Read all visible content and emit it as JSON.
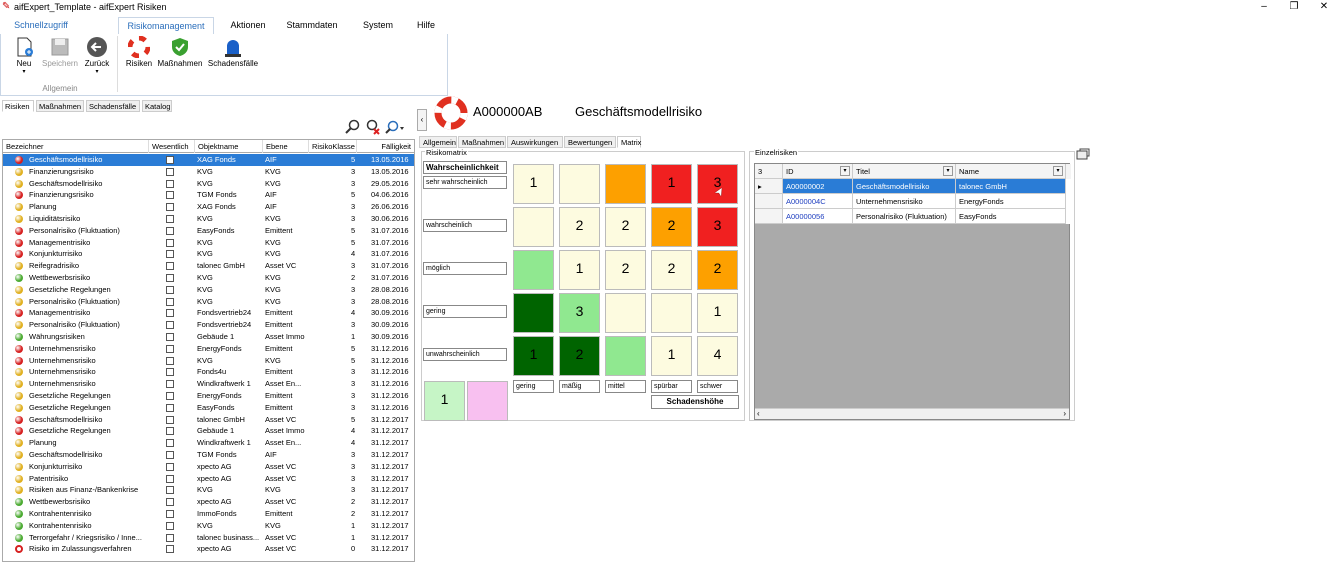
{
  "window": {
    "title": "aifExpert_Template - aifExpert Risiken"
  },
  "ribbon": {
    "tabs": [
      "Schnellzugriff",
      "Risikomanagement",
      "Aktionen",
      "Stammdaten",
      "System",
      "Hilfe"
    ],
    "group_allgemein": "Allgemein",
    "new_label": "Neu",
    "save_label": "Speichern",
    "back_label": "Zurück",
    "risks_label": "Risiken",
    "measures_label": "Maßnahmen",
    "damages_label": "Schadensfälle"
  },
  "left_tabs": [
    "Risiken",
    "Maßnahmen",
    "Schadensfälle",
    "Katalog"
  ],
  "grid": {
    "columns": [
      "Bezeichner",
      "Wesentlich",
      "Objektname",
      "Ebene",
      "RisikoKlasse",
      "Fälligkeit"
    ],
    "rows": [
      {
        "name": "Geschäftsmodellrisiko",
        "obj": "XAG Fonds",
        "level": "AIF",
        "cls": "5",
        "due": "13.05.2016",
        "color": "#d62020",
        "sel": true
      },
      {
        "name": "Finanzierungsrisiko",
        "obj": "KVG",
        "level": "KVG",
        "cls": "3",
        "due": "13.05.2016",
        "color": "#e0b020"
      },
      {
        "name": "Geschäftsmodellrisiko",
        "obj": "KVG",
        "level": "KVG",
        "cls": "3",
        "due": "29.05.2016",
        "color": "#e0b020"
      },
      {
        "name": "Finanzierungsrisiko",
        "obj": "TGM Fonds",
        "level": "AIF",
        "cls": "5",
        "due": "04.06.2016",
        "color": "#d62020"
      },
      {
        "name": "Planung",
        "obj": "XAG Fonds",
        "level": "AIF",
        "cls": "3",
        "due": "26.06.2016",
        "color": "#e0b020"
      },
      {
        "name": "Liquiditätsrisiko",
        "obj": "KVG",
        "level": "KVG",
        "cls": "3",
        "due": "30.06.2016",
        "color": "#e0b020"
      },
      {
        "name": "Personalrisiko (Fluktuation)",
        "obj": "EasyFonds",
        "level": "Emittent",
        "cls": "5",
        "due": "31.07.2016",
        "color": "#d62020"
      },
      {
        "name": "Managementrisiko",
        "obj": "KVG",
        "level": "KVG",
        "cls": "5",
        "due": "31.07.2016",
        "color": "#d62020"
      },
      {
        "name": "Konjunkturrisiko",
        "obj": "KVG",
        "level": "KVG",
        "cls": "4",
        "due": "31.07.2016",
        "color": "#d62020"
      },
      {
        "name": "Reifegradrisiko",
        "obj": "talonec GmbH",
        "level": "Asset VC",
        "cls": "3",
        "due": "31.07.2016",
        "color": "#e0b020"
      },
      {
        "name": "Wettbewerbsrisiko",
        "obj": "KVG",
        "level": "KVG",
        "cls": "2",
        "due": "31.07.2016",
        "color": "#4aaa30"
      },
      {
        "name": "Gesetzliche Regelungen",
        "obj": "KVG",
        "level": "KVG",
        "cls": "3",
        "due": "28.08.2016",
        "color": "#e0b020"
      },
      {
        "name": "Personalrisiko (Fluktuation)",
        "obj": "KVG",
        "level": "KVG",
        "cls": "3",
        "due": "28.08.2016",
        "color": "#e0b020"
      },
      {
        "name": "Managementrisiko",
        "obj": "Fondsvertrieb24",
        "level": "Emittent",
        "cls": "4",
        "due": "30.09.2016",
        "color": "#d62020"
      },
      {
        "name": "Personalrisiko (Fluktuation)",
        "obj": "Fondsvertrieb24",
        "level": "Emittent",
        "cls": "3",
        "due": "30.09.2016",
        "color": "#e0b020"
      },
      {
        "name": "Währungsrisiken",
        "obj": "Gebäude 1",
        "level": "Asset Immo",
        "cls": "1",
        "due": "30.09.2016",
        "color": "#4aaa30"
      },
      {
        "name": "Unternehmensrisiko",
        "obj": "EnergyFonds",
        "level": "Emittent",
        "cls": "5",
        "due": "31.12.2016",
        "color": "#d62020"
      },
      {
        "name": "Unternehmensrisiko",
        "obj": "KVG",
        "level": "KVG",
        "cls": "5",
        "due": "31.12.2016",
        "color": "#d62020"
      },
      {
        "name": "Unternehmensrisiko",
        "obj": "Fonds4u",
        "level": "Emittent",
        "cls": "3",
        "due": "31.12.2016",
        "color": "#e0b020"
      },
      {
        "name": "Unternehmensrisiko",
        "obj": "Windkraftwerk 1",
        "level": "Asset En...",
        "cls": "3",
        "due": "31.12.2016",
        "color": "#e0b020"
      },
      {
        "name": "Gesetzliche Regelungen",
        "obj": "EnergyFonds",
        "level": "Emittent",
        "cls": "3",
        "due": "31.12.2016",
        "color": "#e0b020"
      },
      {
        "name": "Gesetzliche Regelungen",
        "obj": "EasyFonds",
        "level": "Emittent",
        "cls": "3",
        "due": "31.12.2016",
        "color": "#e0b020"
      },
      {
        "name": "Geschäftsmodellrisiko",
        "obj": "talonec GmbH",
        "level": "Asset VC",
        "cls": "5",
        "due": "31.12.2017",
        "color": "#d62020"
      },
      {
        "name": "Gesetzliche Regelungen",
        "obj": "Gebäude 1",
        "level": "Asset Immo",
        "cls": "4",
        "due": "31.12.2017",
        "color": "#d62020"
      },
      {
        "name": "Planung",
        "obj": "Windkraftwerk 1",
        "level": "Asset En...",
        "cls": "4",
        "due": "31.12.2017",
        "color": "#e0b020"
      },
      {
        "name": "Geschäftsmodellrisiko",
        "obj": "TGM Fonds",
        "level": "AIF",
        "cls": "3",
        "due": "31.12.2017",
        "color": "#e0b020"
      },
      {
        "name": "Konjunkturrisiko",
        "obj": "xpecto AG",
        "level": "Asset VC",
        "cls": "3",
        "due": "31.12.2017",
        "color": "#e0b020"
      },
      {
        "name": "Patentrisiko",
        "obj": "xpecto AG",
        "level": "Asset VC",
        "cls": "3",
        "due": "31.12.2017",
        "color": "#e0b020"
      },
      {
        "name": "Risiken aus Finanz-/Bankenkrise",
        "obj": "KVG",
        "level": "KVG",
        "cls": "3",
        "due": "31.12.2017",
        "color": "#e0b020"
      },
      {
        "name": "Wettbewerbsrisiko",
        "obj": "xpecto AG",
        "level": "Asset VC",
        "cls": "2",
        "due": "31.12.2017",
        "color": "#4aaa30"
      },
      {
        "name": "Kontrahentenrisiko",
        "obj": "ImmoFonds",
        "level": "Emittent",
        "cls": "2",
        "due": "31.12.2017",
        "color": "#4aaa30"
      },
      {
        "name": "Kontrahentenrisiko",
        "obj": "KVG",
        "level": "KVG",
        "cls": "1",
        "due": "31.12.2017",
        "color": "#4aaa30"
      },
      {
        "name": "Terrorgefahr / Kriegsrisiko / Inne...",
        "obj": "talonec businass...",
        "level": "Asset VC",
        "cls": "1",
        "due": "31.12.2017",
        "color": "#4aaa30"
      },
      {
        "name": "Risiko im Zulassungsverfahren",
        "obj": "xpecto AG",
        "level": "Asset VC",
        "cls": "0",
        "due": "31.12.2017",
        "color": "#d62020",
        "ring": true
      }
    ]
  },
  "detail": {
    "id": "A000000AB",
    "name": "Geschäftsmodellrisiko",
    "tabs": [
      "Allgemein",
      "Maßnahmen",
      "Auswirkungen",
      "Bewertungen",
      "Matrix"
    ]
  },
  "matrix": {
    "group_label": "Risikomatrix",
    "prob_header": "Wahrscheinlichkeit",
    "prob_labels": [
      "sehr wahrscheinlich",
      "wahrscheinlich",
      "möglich",
      "gering",
      "unwahrscheinlich"
    ],
    "severity_labels": [
      "gering",
      "mäßig",
      "mittel",
      "spürbar",
      "schwer"
    ],
    "severity_header": "Schadenshöhe",
    "cells": [
      [
        {
          "v": "1",
          "c": "#fdfbe0"
        },
        {
          "v": "",
          "c": "#fdfbe0"
        },
        {
          "v": "",
          "c": "#fda000"
        },
        {
          "v": "1",
          "c": "#f02020"
        },
        {
          "v": "3",
          "c": "#f02020"
        }
      ],
      [
        {
          "v": "",
          "c": "#fdfbe0"
        },
        {
          "v": "2",
          "c": "#fdfbe0"
        },
        {
          "v": "2",
          "c": "#fdfbe0"
        },
        {
          "v": "2",
          "c": "#fda000"
        },
        {
          "v": "3",
          "c": "#f02020"
        }
      ],
      [
        {
          "v": "",
          "c": "#90e890"
        },
        {
          "v": "1",
          "c": "#fdfbe0"
        },
        {
          "v": "2",
          "c": "#fdfbe0"
        },
        {
          "v": "2",
          "c": "#fdfbe0"
        },
        {
          "v": "2",
          "c": "#fda000"
        }
      ],
      [
        {
          "v": "",
          "c": "#006400"
        },
        {
          "v": "3",
          "c": "#90e890"
        },
        {
          "v": "",
          "c": "#fdfbe0"
        },
        {
          "v": "",
          "c": "#fdfbe0"
        },
        {
          "v": "1",
          "c": "#fdfbe0"
        }
      ],
      [
        {
          "v": "1",
          "c": "#006400"
        },
        {
          "v": "2",
          "c": "#006400"
        },
        {
          "v": "",
          "c": "#90e890"
        },
        {
          "v": "1",
          "c": "#fdfbe0"
        },
        {
          "v": "4",
          "c": "#fdfbe0"
        }
      ]
    ],
    "legend": [
      {
        "v": "1",
        "c": "#c6f5c6"
      },
      {
        "v": "",
        "c": "#f8c0f0"
      }
    ]
  },
  "einzel": {
    "group_label": "Einzelrisiken",
    "count": "3",
    "columns": [
      "ID",
      "Titel",
      "Name"
    ],
    "rows": [
      {
        "id": "A00000002",
        "title": "Geschäftsmodellrisiko",
        "name": "talonec GmbH",
        "sel": true
      },
      {
        "id": "A0000004C",
        "title": "Unternehmensrisiko",
        "name": "EnergyFonds"
      },
      {
        "id": "A00000056",
        "title": "Personalrisiko (Fluktuation)",
        "name": "EasyFonds"
      }
    ]
  }
}
